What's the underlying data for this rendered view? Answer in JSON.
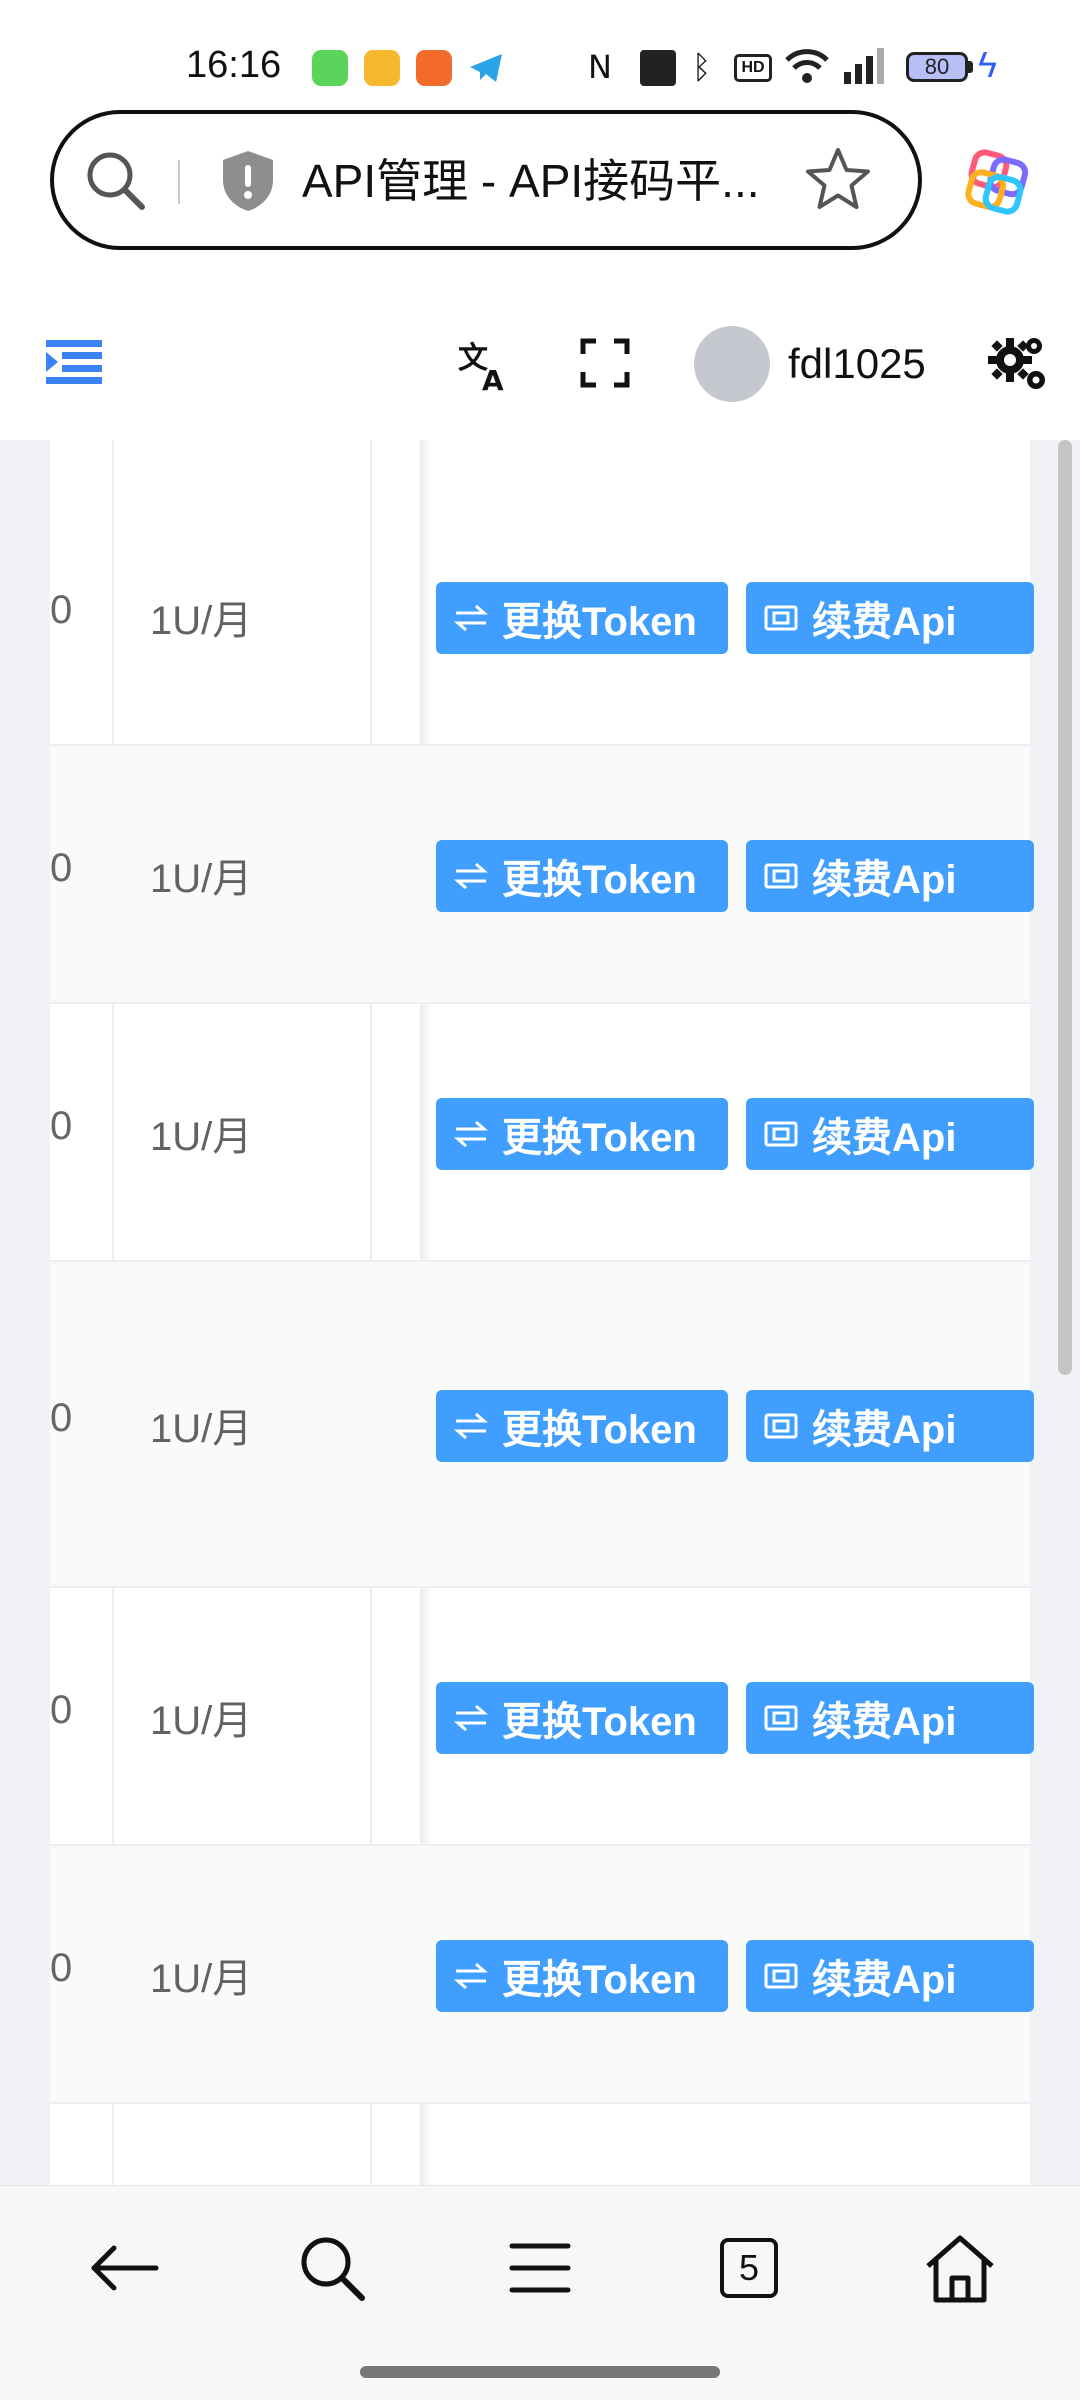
{
  "status_bar": {
    "time": "16:16",
    "battery": "80"
  },
  "address_bar": {
    "title": "API管理 - API接码平..."
  },
  "app_header": {
    "username": "fdl1025"
  },
  "table": {
    "rows": [
      {
        "price": "1U/月",
        "token_btn": "更换Token",
        "renew_btn": "续费Api",
        "cut": "0"
      },
      {
        "price": "1U/月",
        "token_btn": "更换Token",
        "renew_btn": "续费Api",
        "cut": "0"
      },
      {
        "price": "1U/月",
        "token_btn": "更换Token",
        "renew_btn": "续费Api",
        "cut": "0"
      },
      {
        "price": "1U/月",
        "token_btn": "更换Token",
        "renew_btn": "续费Api",
        "cut": "0"
      },
      {
        "price": "1U/月",
        "token_btn": "更换Token",
        "renew_btn": "续费Api",
        "cut": "0"
      },
      {
        "price": "1U/月",
        "token_btn": "更换Token",
        "renew_btn": "续费Api",
        "cut": "0"
      }
    ]
  },
  "bottom_nav": {
    "tab_count": "5"
  },
  "colors": {
    "primary": "#409eff",
    "accent": "#3b82f6"
  }
}
